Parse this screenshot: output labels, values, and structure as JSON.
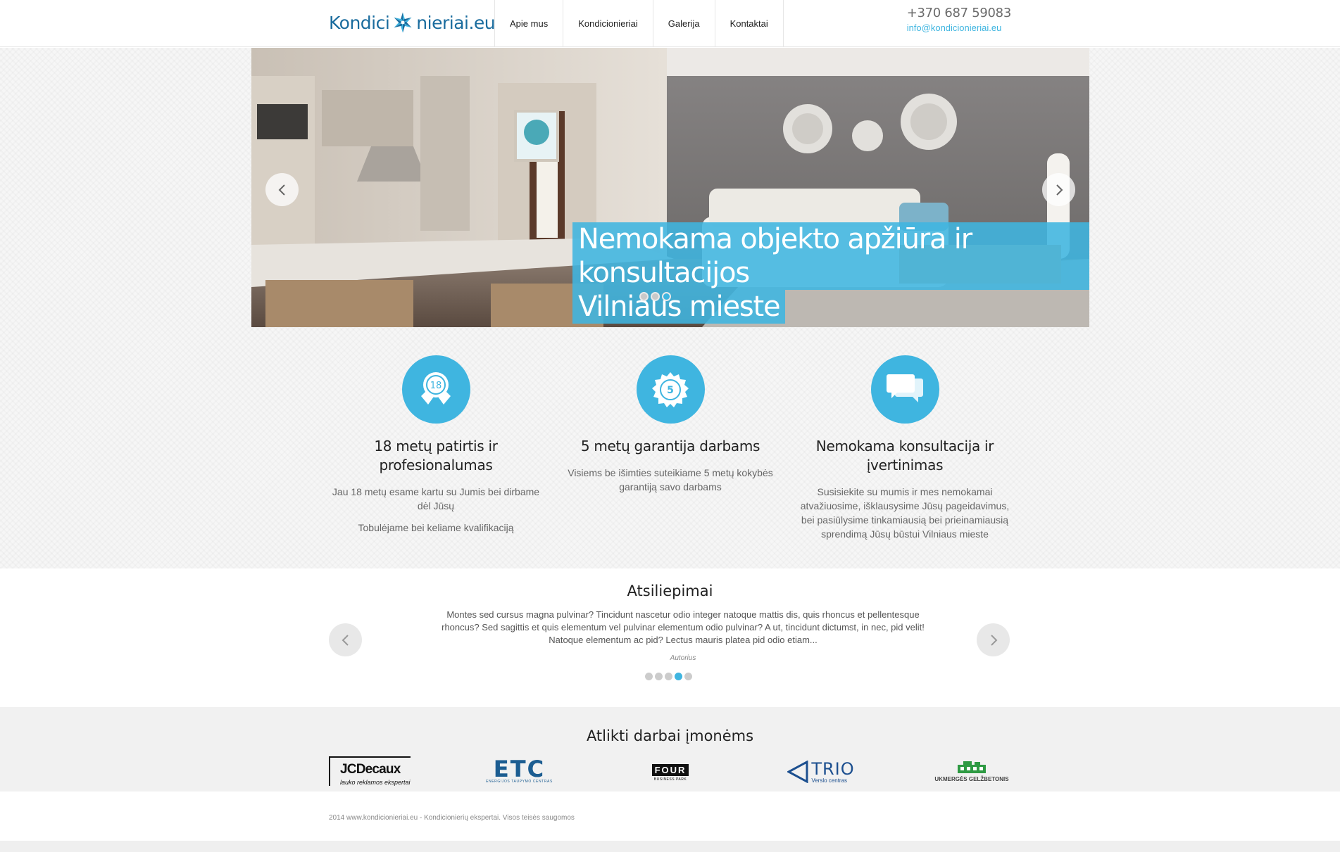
{
  "header": {
    "logo_part1": "Kondici",
    "logo_part2": "nieriai.eu",
    "nav": [
      "Apie mus",
      "Kondicionieriai",
      "Galerija",
      "Kontaktai"
    ],
    "phone": "+370 687 59083",
    "email": "info@kondicionieriai.eu"
  },
  "slider": {
    "caption_line1": "Nemokama objekto apžiūra ir konsultacijos",
    "caption_line2": "Vilniaus mieste",
    "dots": 3,
    "active_dot": 3,
    "prev_icon": "chevron-left-icon",
    "next_icon": "chevron-right-icon"
  },
  "features": [
    {
      "icon": "award-ribbon-icon",
      "icon_text": "18",
      "title": "18 metų patirtis ir profesionalumas",
      "text": "Jau 18 metų esame kartu su Jumis bei dirbame dėl Jūsų",
      "text2": "Tobulėjame bei keliame kvalifikaciją"
    },
    {
      "icon": "warranty-seal-icon",
      "icon_text": "5",
      "title": "5 metų garantija darbams",
      "text": "Visiems be išimties suteikiame 5 metų kokybės garantiją savo darbams",
      "text2": ""
    },
    {
      "icon": "chat-bubbles-icon",
      "icon_text": "",
      "title": "Nemokama konsultacija ir įvertinimas",
      "text": "Susisiekite su mumis ir mes nemokamai atvažiuosime, išklausysime Jūsų pageidavimus, bei pasiūlysime tinkamiausią bei prieinamiausią sprendimą Jūsų būstui Vilniaus mieste",
      "text2": ""
    }
  ],
  "testimonials": {
    "title": "Atsiliepimai",
    "text": "Montes sed cursus magna pulvinar? Tincidunt nascetur odio integer natoque mattis dis, quis rhoncus et pellentesque rhoncus? Sed sagittis et quis elementum vel pulvinar elementum odio pulvinar? A ut, tincidunt dictumst, in nec, pid velit! Natoque elementum ac pid? Lectus mauris platea pid odio etiam...",
    "author": "Autorius",
    "dots": 5,
    "active_dot": 4
  },
  "partners": {
    "title": "Atlikti darbai įmonėms",
    "items": [
      {
        "name": "JCDecaux",
        "tagline": "lauko reklamos ekspertai"
      },
      {
        "name": "ETC",
        "tagline": "ENERGIJOS TAUPYMO CENTRAS"
      },
      {
        "name": "FOUR",
        "tagline": "BUSINESS PARK"
      },
      {
        "name": "TRIO",
        "tagline": "Verslo centras"
      },
      {
        "name": "UKMERGĖS GELŽBETONIS",
        "tagline": ""
      }
    ]
  },
  "footer": {
    "copyright": "2014 www.kondicionieriai.eu - Kondicionierių ekspertai. Visos teisės saugomos"
  },
  "colors": {
    "accent": "#3fb5e0",
    "brand": "#1a6c9e"
  }
}
